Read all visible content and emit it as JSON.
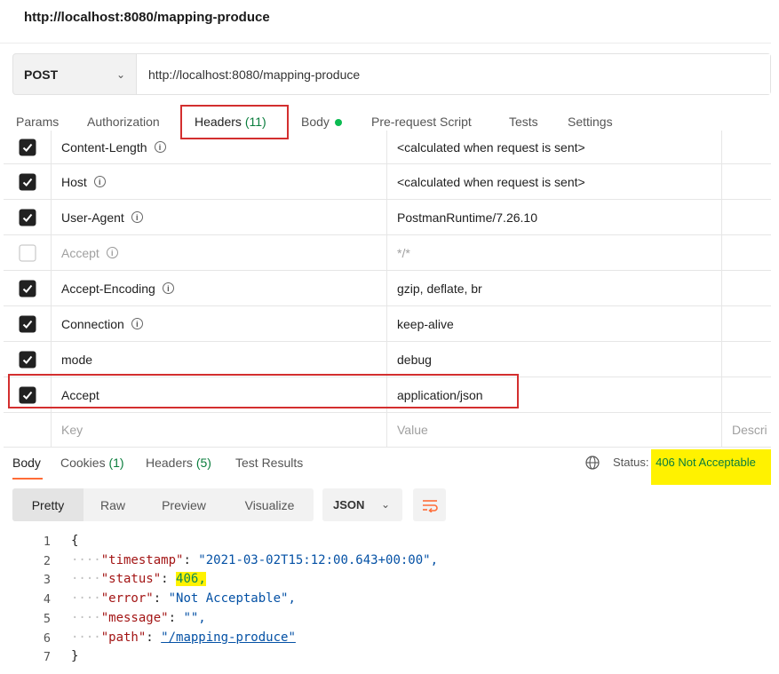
{
  "window_title": "http://localhost:8080/mapping-produce",
  "request": {
    "method": "POST",
    "url": "http://localhost:8080/mapping-produce"
  },
  "request_tabs": [
    {
      "label": "Params"
    },
    {
      "label": "Authorization"
    },
    {
      "label": "Headers",
      "count": "(11)"
    },
    {
      "label": "Body"
    },
    {
      "label": "Pre-request Script"
    },
    {
      "label": "Tests"
    },
    {
      "label": "Settings"
    }
  ],
  "headers": [
    {
      "key": "Content-Length",
      "value": "<calculated when request is sent>",
      "checked": true,
      "info": true
    },
    {
      "key": "Host",
      "value": "<calculated when request is sent>",
      "checked": true,
      "info": true
    },
    {
      "key": "User-Agent",
      "value": "PostmanRuntime/7.26.10",
      "checked": true,
      "info": true
    },
    {
      "key": "Accept",
      "value": "*/*",
      "checked": false,
      "info": true
    },
    {
      "key": "Accept-Encoding",
      "value": "gzip, deflate, br",
      "checked": true,
      "info": true
    },
    {
      "key": "Connection",
      "value": "keep-alive",
      "checked": true,
      "info": true
    },
    {
      "key": "mode",
      "value": "debug",
      "checked": true,
      "info": false
    },
    {
      "key": "Accept",
      "value": "application/json",
      "checked": true,
      "info": false
    }
  ],
  "new_row": {
    "key_placeholder": "Key",
    "value_placeholder": "Value",
    "desc_placeholder": "Descri"
  },
  "response_tabs": [
    {
      "label": "Body"
    },
    {
      "label": "Cookies",
      "count": "(1)"
    },
    {
      "label": "Headers",
      "count": "(5)"
    },
    {
      "label": "Test Results"
    }
  ],
  "status": {
    "label": "Status:",
    "value": "406 Not Acceptable"
  },
  "view_modes": [
    "Pretty",
    "Raw",
    "Preview",
    "Visualize"
  ],
  "format": "JSON",
  "body_lines": [
    {
      "n": "1",
      "text": "{"
    },
    {
      "n": "2",
      "key": "\"timestamp\"",
      "val": "\"2021-03-02T15:12:00.643+00:00\"",
      "end": ","
    },
    {
      "n": "3",
      "key": "\"status\"",
      "val": "406",
      "end": ","
    },
    {
      "n": "4",
      "key": "\"error\"",
      "val": "\"Not Acceptable\"",
      "end": ","
    },
    {
      "n": "5",
      "key": "\"message\"",
      "val": "\"\"",
      "end": ","
    },
    {
      "n": "6",
      "key": "\"path\"",
      "val": "\"/mapping-produce\"",
      "end": ""
    },
    {
      "n": "7",
      "text": "}"
    }
  ],
  "colors": {
    "accent": "#ff6c37",
    "highlight": "#fff200",
    "annotation": "#d32f2f",
    "success": "#0a7d3d"
  }
}
